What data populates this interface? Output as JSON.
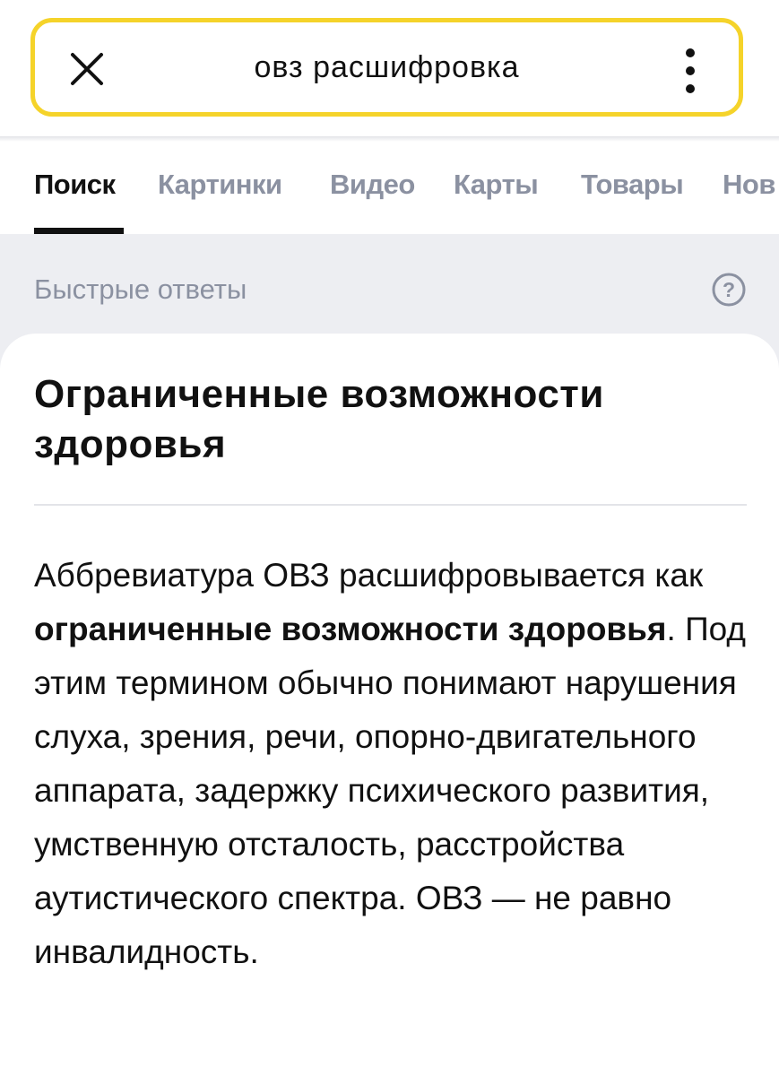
{
  "search": {
    "query": "овз расшифровка"
  },
  "tabs": [
    {
      "label": "Поиск",
      "active": true
    },
    {
      "label": "Картинки",
      "active": false
    },
    {
      "label": "Видео",
      "active": false
    },
    {
      "label": "Карты",
      "active": false
    },
    {
      "label": "Товары",
      "active": false
    },
    {
      "label": "Нов",
      "active": false
    }
  ],
  "quick_answers": {
    "section_title": "Быстрые ответы",
    "card_title": "Ограниченные возможности здоровья",
    "body": {
      "part1": "Аббревиатура ОВЗ расшифровывается как ",
      "bold": "ограниченные возможности здоровья",
      "part2": ". Под этим термином обычно понимают нарушения слуха, зрения, речи, опорно-двигательного аппарата, задержку психического развития, умственную отсталость, расстройства аутистического спектра. ОВЗ — не равно инвалидность."
    }
  },
  "icons": {
    "close": "close-icon",
    "more": "more-vertical-icon",
    "help": "help-circle-icon"
  },
  "colors": {
    "search_border": "#f5d32a",
    "tab_inactive": "#8b91a1",
    "tab_active": "#111111",
    "grey_background": "#edeef2"
  }
}
